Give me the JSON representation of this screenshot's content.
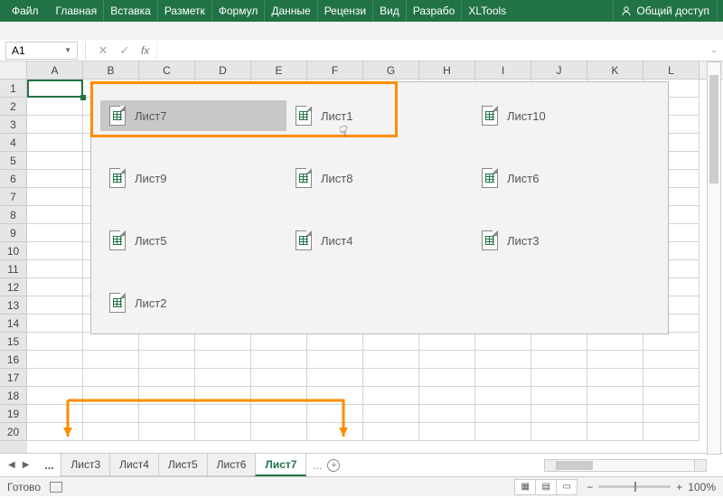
{
  "ribbon": {
    "tabs": [
      "Файл",
      "Главная",
      "Вставка",
      "Разметк",
      "Формул",
      "Данные",
      "Рецензи",
      "Вид",
      "Разрабо",
      "XLTools"
    ],
    "share": "Общий доступ"
  },
  "namebox": {
    "value": "A1"
  },
  "fx": {
    "cancel": "✕",
    "confirm": "✓",
    "label": "fx"
  },
  "columns": [
    "A",
    "B",
    "C",
    "D",
    "E",
    "F",
    "G",
    "H",
    "I",
    "J",
    "K",
    "L"
  ],
  "rows": [
    "1",
    "2",
    "3",
    "4",
    "5",
    "6",
    "7",
    "8",
    "9",
    "10",
    "11",
    "12",
    "13",
    "14",
    "15",
    "16",
    "17",
    "18",
    "19",
    "20"
  ],
  "sheet_panel": {
    "items": [
      {
        "label": "Лист7",
        "selected": true
      },
      {
        "label": "Лист1",
        "selected": false
      },
      {
        "label": "Лист10",
        "selected": false
      },
      {
        "label": "Лист9",
        "selected": false
      },
      {
        "label": "Лист8",
        "selected": false
      },
      {
        "label": "Лист6",
        "selected": false
      },
      {
        "label": "Лист5",
        "selected": false
      },
      {
        "label": "Лист4",
        "selected": false
      },
      {
        "label": "Лист3",
        "selected": false
      },
      {
        "label": "Лист2",
        "selected": false
      }
    ]
  },
  "tabs": {
    "dots": "...",
    "items": [
      {
        "label": "Лист3",
        "active": false
      },
      {
        "label": "Лист4",
        "active": false
      },
      {
        "label": "Лист5",
        "active": false
      },
      {
        "label": "Лист6",
        "active": false
      },
      {
        "label": "Лист7",
        "active": true
      }
    ],
    "dots2": "...",
    "add": "+"
  },
  "status": {
    "ready": "Готово",
    "zoom": "100%",
    "minus": "−",
    "plus": "+"
  },
  "accent": "#217346",
  "annotation": "#ff8c00"
}
